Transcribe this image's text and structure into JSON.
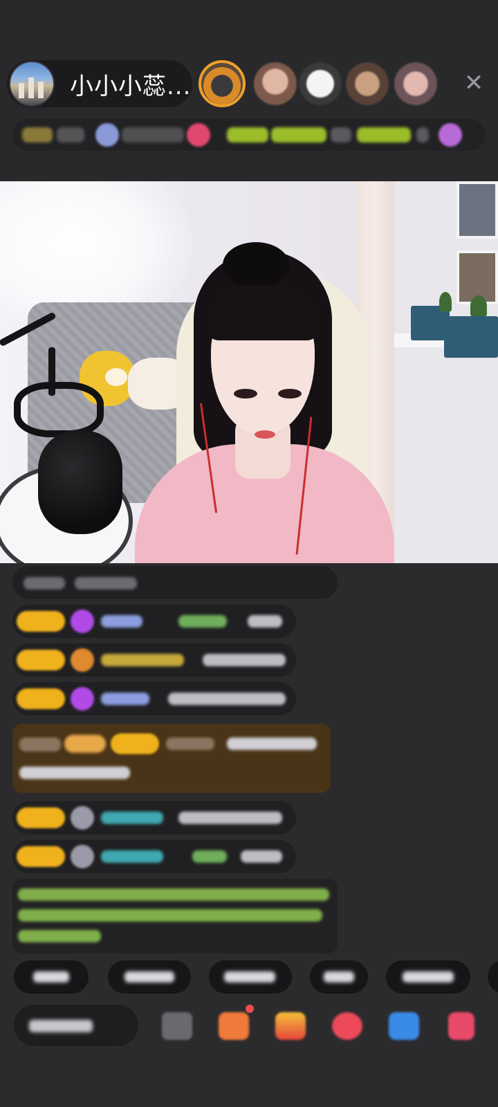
{
  "header": {
    "host_name": "小小小蕊...",
    "close_icon": "close-icon"
  },
  "colors": {
    "background": "#2b2b2d",
    "badge": "#f0b21c",
    "highlight_message": "#4a3417",
    "notice_text": "#8fbf4f"
  },
  "quick_replies_count": 6,
  "icons": {
    "bottom_actions": [
      "chat-icon",
      "gift-box-icon",
      "gift-icon",
      "heart-gift-icon",
      "game-icon",
      "more-icon"
    ]
  }
}
